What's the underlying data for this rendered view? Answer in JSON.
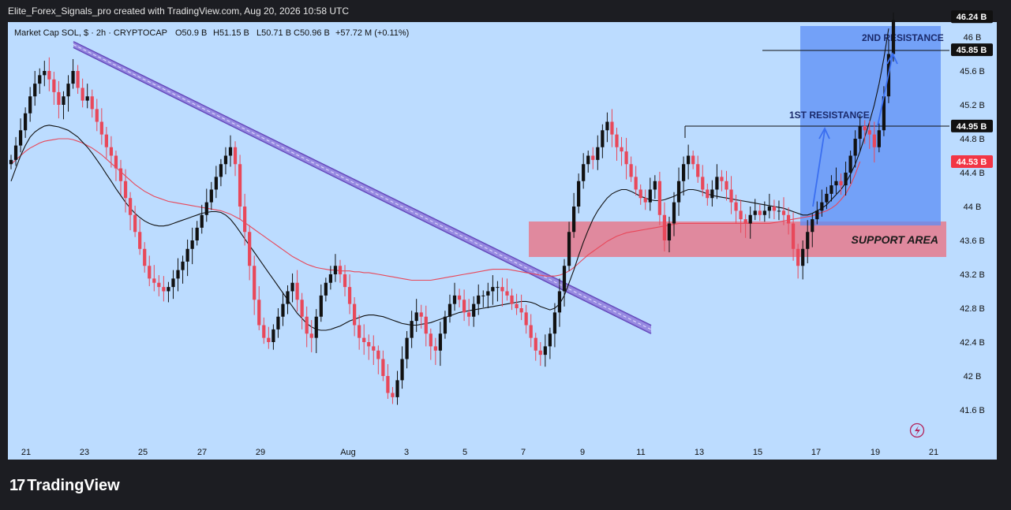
{
  "header": {
    "credit": "Elite_Forex_Signals_pro created with TradingView.com, Aug 20, 2026 10:58 UTC"
  },
  "legend": {
    "symbol": "Market Cap SOL, $ · 2h · CRYPTOCAP",
    "open": "O50.9 B",
    "high": "H51.15 B",
    "low": "L50.71 B",
    "close": "C50.96 B",
    "change": "+57.72 M (+0.11%)"
  },
  "footer": {
    "brand": "TradingView"
  },
  "colors": {
    "background": "#bcdcff",
    "up_candle": "#111111",
    "down_candle": "#e8485a",
    "ma_fast": "#111111",
    "ma_slow": "#e8485a",
    "trendline": "#5b3fb5",
    "support_zone": "#e67a8d",
    "projection_box": "#5b8ef5"
  },
  "chart_data": {
    "type": "candlestick",
    "x_ticks": [
      "21",
      "23",
      "25",
      "27",
      "29",
      "Aug",
      "3",
      "5",
      "7",
      "9",
      "11",
      "13",
      "15",
      "17",
      "19",
      "21"
    ],
    "y_ticks": [
      "41.6B",
      "42B",
      "42.4B",
      "42.8B",
      "43.2B",
      "43.6B",
      "44B",
      "44.4B",
      "44.8B",
      "45.2B",
      "45.6B",
      "46B"
    ],
    "ylim": [
      41.2,
      46.3
    ],
    "price_labels": [
      {
        "text": "46.24 B",
        "value": 46.24,
        "style": "dark"
      },
      {
        "text": "45.85 B",
        "value": 45.85,
        "style": "dark"
      },
      {
        "text": "44.95 B",
        "value": 44.95,
        "style": "dark"
      },
      {
        "text": "44.53 B",
        "value": 44.53,
        "style": "red"
      }
    ],
    "annotations": {
      "first_resistance": {
        "text": "1ST RESISTANCE",
        "value": 44.95
      },
      "second_resistance": {
        "text": "2ND RESISTANCE",
        "value": 45.85
      },
      "support_area": {
        "text": "SUPPORT AREA",
        "low": 43.43,
        "high": 43.83
      }
    },
    "closes": [
      44.55,
      44.72,
      44.9,
      45.1,
      45.3,
      45.45,
      45.55,
      45.6,
      45.5,
      45.35,
      45.2,
      45.3,
      45.45,
      45.6,
      45.4,
      45.25,
      45.3,
      45.15,
      45.0,
      44.85,
      44.7,
      44.6,
      44.45,
      44.3,
      44.1,
      43.9,
      43.7,
      43.5,
      43.3,
      43.15,
      43.1,
      43.05,
      43.0,
      43.05,
      43.15,
      43.25,
      43.35,
      43.5,
      43.6,
      43.75,
      43.9,
      44.05,
      44.2,
      44.35,
      44.5,
      44.6,
      44.7,
      44.5,
      44.0,
      43.7,
      43.3,
      42.9,
      42.6,
      42.45,
      42.4,
      42.55,
      42.7,
      42.85,
      43.0,
      43.1,
      42.9,
      42.7,
      42.5,
      42.45,
      42.7,
      42.95,
      43.1,
      43.2,
      43.3,
      43.2,
      43.05,
      42.85,
      42.6,
      42.45,
      42.4,
      42.35,
      42.3,
      42.2,
      42.0,
      41.8,
      41.75,
      41.95,
      42.2,
      42.45,
      42.65,
      42.75,
      42.7,
      42.5,
      42.35,
      42.3,
      42.5,
      42.7,
      42.85,
      42.95,
      42.9,
      42.75,
      42.7,
      42.85,
      42.95,
      42.95,
      43.0,
      43.05,
      43.05,
      43.0,
      42.95,
      42.85,
      42.8,
      42.75,
      42.6,
      42.45,
      42.3,
      42.25,
      42.35,
      42.5,
      42.75,
      43.0,
      43.3,
      43.7,
      44.0,
      44.3,
      44.5,
      44.6,
      44.55,
      44.7,
      44.9,
      45.0,
      44.85,
      44.7,
      44.65,
      44.5,
      44.35,
      44.2,
      44.1,
      44.05,
      44.2,
      44.3,
      43.9,
      43.6,
      43.8,
      44.05,
      44.3,
      44.5,
      44.6,
      44.5,
      44.35,
      44.2,
      44.1,
      44.2,
      44.35,
      44.3,
      44.2,
      44.05,
      43.95,
      43.85,
      43.8,
      43.9,
      43.95,
      43.9,
      43.95,
      44.0,
      43.95,
      43.95,
      43.9,
      43.8,
      43.5,
      43.3,
      43.5,
      43.7,
      43.85,
      43.95,
      44.05,
      44.15,
      44.25,
      44.3,
      44.25,
      44.4,
      44.6,
      44.8,
      44.95,
      44.9,
      44.85,
      44.7,
      44.9,
      45.3,
      45.8,
      46.2
    ],
    "ma_fast": [
      44.3,
      44.45,
      44.6,
      44.72,
      44.82,
      44.88,
      44.92,
      44.95,
      44.96,
      44.95,
      44.94,
      44.92,
      44.9,
      44.86,
      44.82,
      44.76,
      44.7,
      44.63,
      44.55,
      44.47,
      44.38,
      44.3,
      44.21,
      44.13,
      44.05,
      43.98,
      43.92,
      43.87,
      43.83,
      43.8,
      43.78,
      43.77,
      43.77,
      43.78,
      43.8,
      43.82,
      43.84,
      43.86,
      43.88,
      43.9,
      43.92,
      43.93,
      43.94,
      43.94,
      43.93,
      43.9,
      43.85,
      43.78,
      43.7,
      43.62,
      43.54,
      43.46,
      43.38,
      43.3,
      43.22,
      43.14,
      43.06,
      42.98,
      42.9,
      42.82,
      42.74,
      42.68,
      42.62,
      42.58,
      42.55,
      42.54,
      42.54,
      42.55,
      42.57,
      42.59,
      42.62,
      42.65,
      42.67,
      42.69,
      42.71,
      42.72,
      42.72,
      42.71,
      42.7,
      42.68,
      42.66,
      42.64,
      42.62,
      42.61,
      42.6,
      42.6,
      42.61,
      42.62,
      42.63,
      42.65,
      42.67,
      42.69,
      42.71,
      42.73,
      42.75,
      42.76,
      42.77,
      42.78,
      42.79,
      42.8,
      42.81,
      42.82,
      42.83,
      42.84,
      42.85,
      42.86,
      42.87,
      42.88,
      42.88,
      42.87,
      42.85,
      42.82,
      42.8,
      42.78,
      42.8,
      42.85,
      42.95,
      43.1,
      43.25,
      43.42,
      43.58,
      43.72,
      43.85,
      43.95,
      44.03,
      44.1,
      44.15,
      44.18,
      44.2,
      44.2,
      44.18,
      44.15,
      44.12,
      44.1,
      44.08,
      44.07,
      44.07,
      44.08,
      44.1,
      44.12,
      44.15,
      44.18,
      44.2,
      44.2,
      44.19,
      44.17,
      44.15,
      44.13,
      44.12,
      44.11,
      44.1,
      44.09,
      44.08,
      44.07,
      44.06,
      44.05,
      44.04,
      44.03,
      44.02,
      44.01,
      44.0,
      43.99,
      43.98,
      43.96,
      43.94,
      43.92,
      43.9,
      43.9,
      43.92,
      43.95,
      43.98,
      44.02,
      44.08,
      44.14,
      44.2,
      44.28,
      44.38,
      44.5,
      44.65,
      44.82,
      45.0,
      45.2,
      45.45,
      45.75,
      46.1
    ],
    "ma_slow": [
      44.5,
      44.55,
      44.6,
      44.65,
      44.69,
      44.72,
      44.75,
      44.77,
      44.78,
      44.79,
      44.8,
      44.8,
      44.8,
      44.79,
      44.77,
      44.75,
      44.72,
      44.69,
      44.65,
      44.61,
      44.56,
      44.51,
      44.46,
      44.41,
      44.36,
      44.31,
      44.26,
      44.22,
      44.18,
      44.15,
      44.12,
      44.1,
      44.08,
      44.06,
      44.05,
      44.04,
      44.03,
      44.02,
      44.01,
      44.0,
      43.99,
      43.98,
      43.97,
      43.96,
      43.95,
      43.93,
      43.91,
      43.88,
      43.85,
      43.81,
      43.77,
      43.73,
      43.69,
      43.65,
      43.61,
      43.57,
      43.53,
      43.49,
      43.45,
      43.41,
      43.38,
      43.35,
      43.32,
      43.3,
      43.28,
      43.27,
      43.26,
      43.25,
      43.25,
      43.24,
      43.24,
      43.24,
      43.23,
      43.23,
      43.22,
      43.22,
      43.21,
      43.2,
      43.19,
      43.18,
      43.17,
      43.16,
      43.15,
      43.14,
      43.13,
      43.13,
      43.13,
      43.13,
      43.13,
      43.14,
      43.15,
      43.16,
      43.17,
      43.18,
      43.19,
      43.2,
      43.21,
      43.22,
      43.23,
      43.24,
      43.25,
      43.26,
      43.26,
      43.26,
      43.26,
      43.25,
      43.24,
      43.23,
      43.22,
      43.21,
      43.2,
      43.19,
      43.18,
      43.18,
      43.18,
      43.19,
      43.21,
      43.24,
      43.28,
      43.33,
      43.38,
      43.43,
      43.47,
      43.51,
      43.55,
      43.59,
      43.62,
      43.65,
      43.67,
      43.69,
      43.7,
      43.71,
      43.72,
      43.73,
      43.74,
      43.75,
      43.76,
      43.77,
      43.78,
      43.79,
      43.8,
      43.8,
      43.8,
      43.8,
      43.8,
      43.8,
      43.8,
      43.8,
      43.8,
      43.8,
      43.8,
      43.8,
      43.8,
      43.8,
      43.8,
      43.8,
      43.8,
      43.8,
      43.8,
      43.8,
      43.81,
      43.82,
      43.83,
      43.84,
      43.85,
      43.86,
      43.87,
      43.88,
      43.89,
      43.91,
      43.93,
      43.95,
      43.98,
      44.02,
      44.08,
      44.15,
      44.25,
      44.38,
      44.53
    ]
  }
}
